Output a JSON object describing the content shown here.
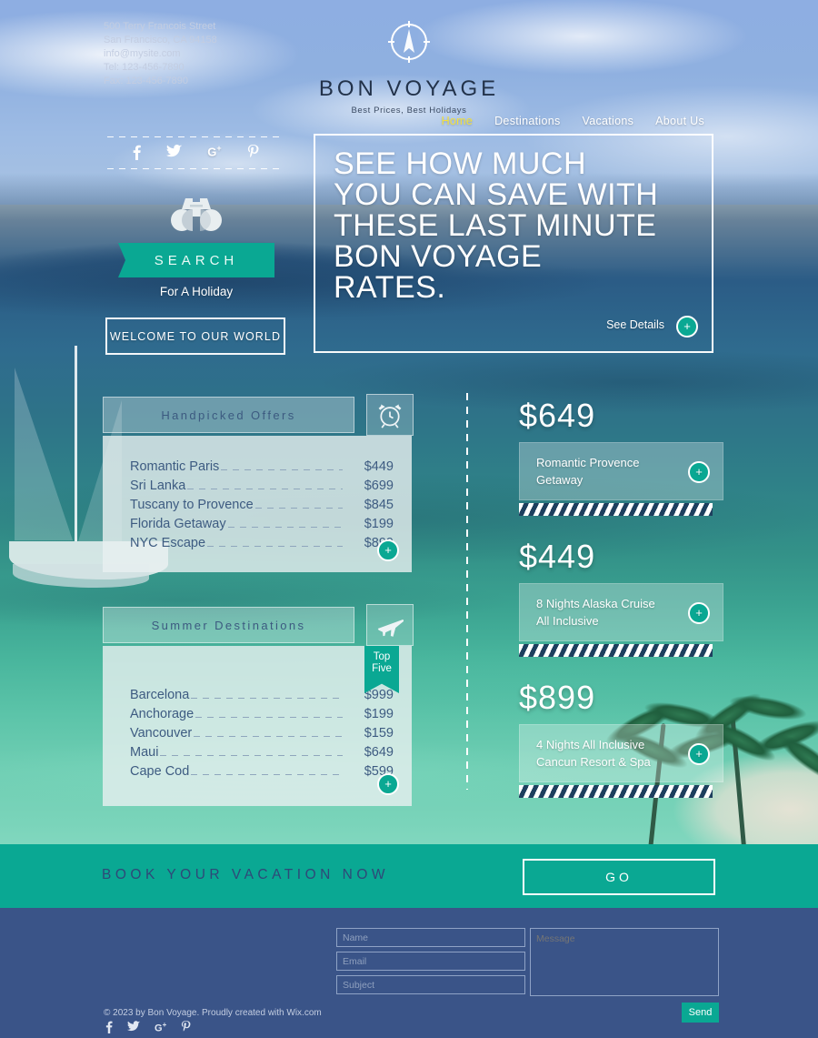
{
  "brand": {
    "name": "BON VOYAGE",
    "tagline": "Best Prices, Best Holidays",
    "logo_icon": "compass-icon"
  },
  "nav": {
    "items": [
      {
        "label": "Home",
        "active": true
      },
      {
        "label": "Destinations",
        "active": false
      },
      {
        "label": "Vacations",
        "active": false
      },
      {
        "label": "About Us",
        "active": false
      }
    ]
  },
  "social": {
    "icons": [
      "facebook-icon",
      "twitter-icon",
      "google-plus-icon",
      "pinterest-icon"
    ],
    "glyphs": [
      "f",
      "🐦",
      "G+",
      "𝑷"
    ]
  },
  "search": {
    "icon": "binoculars-icon",
    "label": "SEARCH",
    "subtitle": "For A Holiday"
  },
  "welcome": {
    "label": "WELCOME TO OUR WORLD"
  },
  "hero": {
    "line1": "SEE HOW MUCH",
    "line2": "YOU CAN SAVE WITH",
    "line3": "THESE LAST MINUTE",
    "line4": "BON VOYAGE",
    "line5": "RATES.",
    "cta": "See Details",
    "plus": "+"
  },
  "offers_panel": {
    "title": "Handpicked Offers",
    "icon": "alarm-clock-icon",
    "plus": "+",
    "rows": [
      {
        "name": "Romantic Paris",
        "price": "$449"
      },
      {
        "name": "Sri Lanka",
        "price": "$699"
      },
      {
        "name": "Tuscany to Provence",
        "price": "$845"
      },
      {
        "name": "Florida Getaway",
        "price": "$199"
      },
      {
        "name": "NYC Escape",
        "price": "$899"
      }
    ]
  },
  "destinations_panel": {
    "title": "Summer Destinations",
    "icon": "airplane-icon",
    "plus": "+",
    "badge_line1": "Top",
    "badge_line2": "Five",
    "rows": [
      {
        "name": "Barcelona",
        "price": "$999"
      },
      {
        "name": "Anchorage",
        "price": "$199"
      },
      {
        "name": "Vancouver",
        "price": "$159"
      },
      {
        "name": "Maui",
        "price": "$649"
      },
      {
        "name": "Cape Cod",
        "price": "$599"
      }
    ]
  },
  "price_cards": [
    {
      "amount": "$649",
      "line1": "Romantic Provence",
      "line2": "Getaway",
      "plus": "+"
    },
    {
      "amount": "$449",
      "line1": "8 Nights Alaska Cruise",
      "line2": "All Inclusive",
      "plus": "+"
    },
    {
      "amount": "$899",
      "line1": "4 Nights All Inclusive",
      "line2": "Cancun Resort & Spa",
      "plus": "+"
    }
  ],
  "booking": {
    "heading": "BOOK YOUR VACATION NOW",
    "go_label": "GO"
  },
  "footer": {
    "address_line1": "500 Terry Francois Street",
    "address_line2": "San Francisco, CA 94158",
    "email": "info@mysite.com",
    "tel": "Tel: 123-456-7890",
    "fax": "Fax: 123-456-7890",
    "copyright": "© 2023 by Bon Voyage. Proudly created with Wix.com",
    "social_icons": [
      "facebook-icon",
      "twitter-icon",
      "google-plus-icon",
      "pinterest-icon"
    ]
  },
  "form": {
    "name_placeholder": "Name",
    "email_placeholder": "Email",
    "subject_placeholder": "Subject",
    "message_placeholder": "Message",
    "send_label": "Send"
  },
  "colors": {
    "teal": "#0aa893",
    "footer_navy": "#3a5488",
    "nav_active": "#f4e23c",
    "panel_text": "#3d5b81"
  }
}
